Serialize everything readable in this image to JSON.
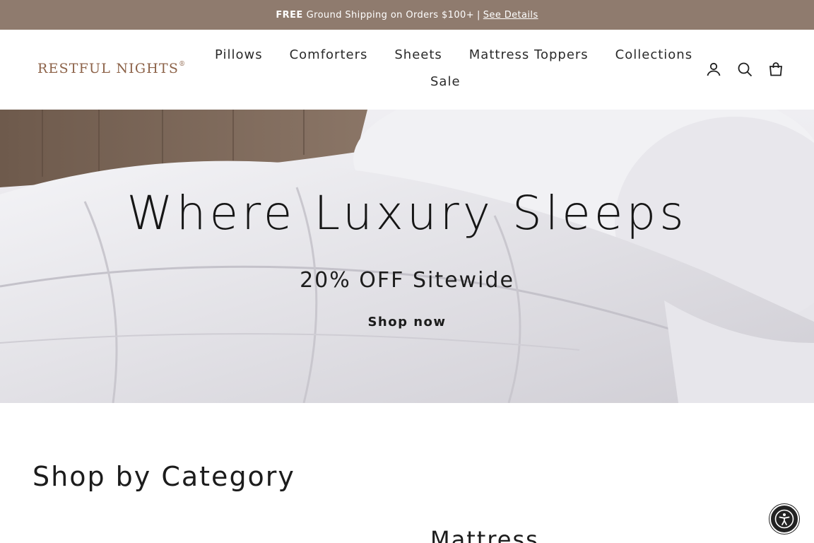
{
  "promo": {
    "bold": "FREE",
    "text": "Ground Shipping on Orders $100+",
    "separator": "|",
    "link": "See Details"
  },
  "header": {
    "logo": "RESTFUL NIGHTS",
    "logo_mark": "®",
    "nav": [
      "Pillows",
      "Comforters",
      "Sheets",
      "Mattress Toppers",
      "Collections",
      "Sale"
    ],
    "icons": [
      "account-icon",
      "search-icon",
      "cart-icon"
    ]
  },
  "hero": {
    "title": "Where Luxury Sleeps",
    "subtitle": "20% OFF Sitewide",
    "cta": "Shop now"
  },
  "category_section": {
    "title": "Shop by Category",
    "visible_category": "Mattress"
  },
  "widgets": {
    "accessibility_icon": "accessibility-icon"
  },
  "colors": {
    "promo_bar": "#8f7b6e",
    "logo": "#8c6248",
    "text": "#1c1c1c"
  }
}
